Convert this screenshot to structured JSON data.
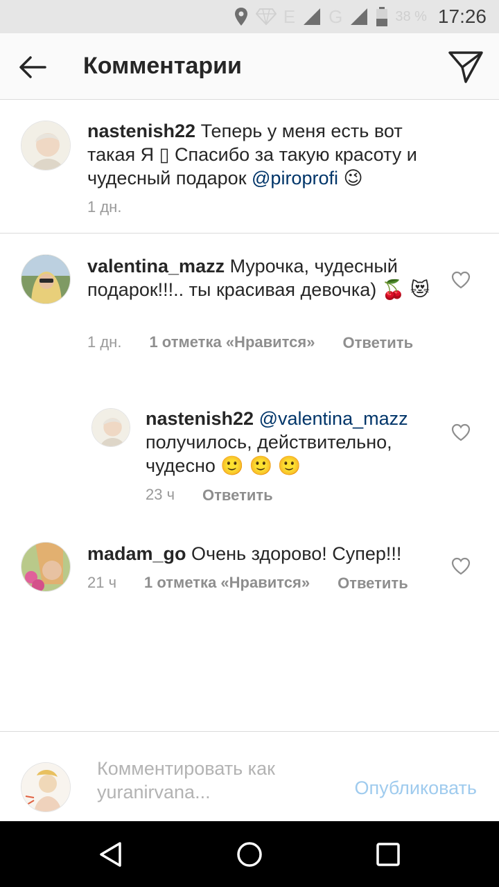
{
  "status_bar": {
    "battery_percent": "38 %",
    "time": "17:26",
    "network_letters": [
      "E",
      "G"
    ],
    "icons": [
      "location-icon",
      "diamond-icon",
      "signal-icon",
      "battery-icon"
    ]
  },
  "header": {
    "title": "Комментарии",
    "back_icon": "arrow-left-icon",
    "send_icon": "paper-plane-icon"
  },
  "comments": [
    {
      "username": "nastenish22",
      "text_before": " Теперь у меня есть вот такая Я ▯ Спасибо за такую красоту и чудесный подарок ",
      "mention": "@piroprofi",
      "text_after": " 😉",
      "time": "1 дн.",
      "likes": "",
      "reply": ""
    },
    {
      "username": "valentina_mazz",
      "text_before": " Мурочка, чудесный подарок!!!.. ты красивая девочка) 🍒 😻",
      "mention": "",
      "text_after": "",
      "time": "1 дн.",
      "likes": "1 отметка «Нравится»",
      "reply": "Ответить"
    },
    {
      "username": "nastenish22",
      "text_before": " ",
      "mention": "@valentina_mazz",
      "text_after": " получилось, действительно, чудесно 🙂 🙂 🙂",
      "time": "23 ч",
      "likes": "",
      "reply": "Ответить"
    },
    {
      "username": "madam_go",
      "text_before": " Очень здорово! Супер!!!",
      "mention": "",
      "text_after": "",
      "time": "21 ч",
      "likes": "1 отметка «Нравится»",
      "reply": "Ответить"
    }
  ],
  "composer": {
    "placeholder": "Комментировать как yuranirvana...",
    "publish_label": "Опубликовать"
  },
  "colors": {
    "mention": "#003569",
    "publish": "#9fcbee",
    "meta": "#999999",
    "status_bar": "#e6e6e6"
  }
}
